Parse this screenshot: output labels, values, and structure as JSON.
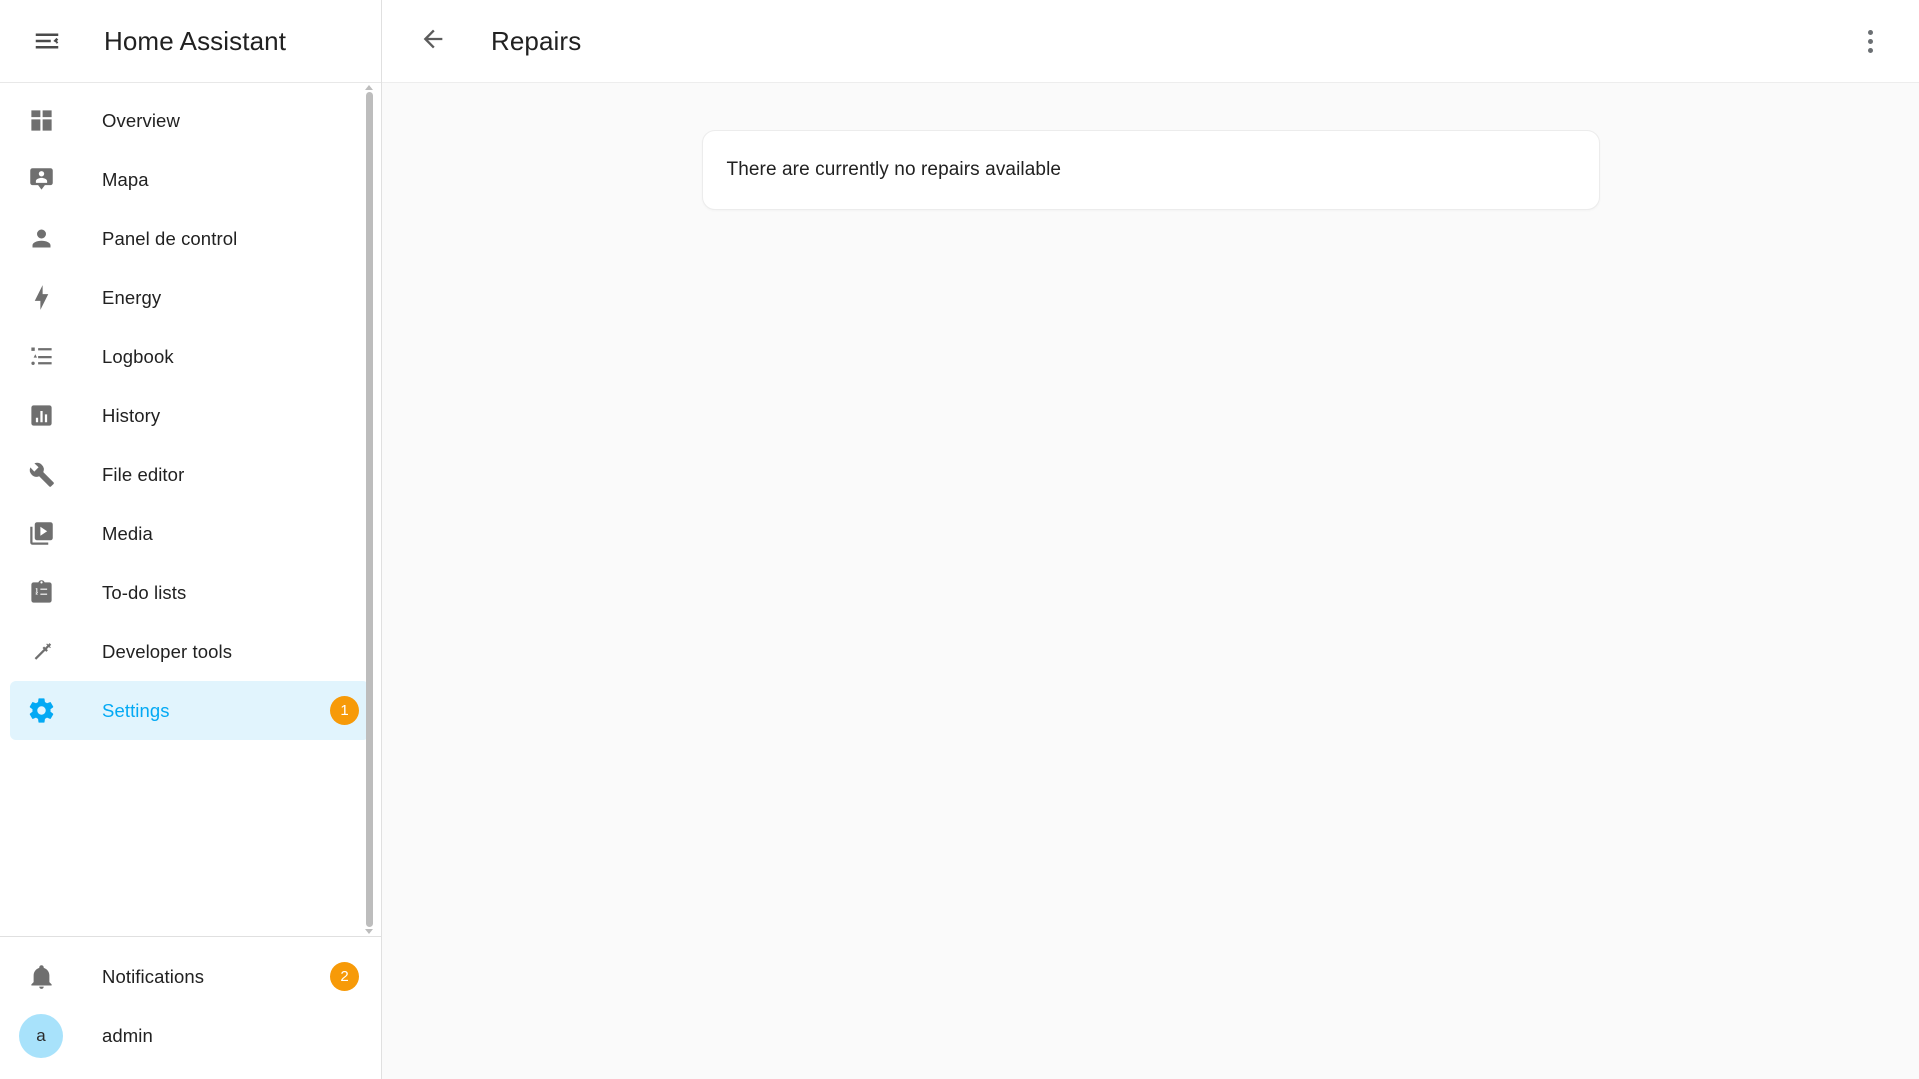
{
  "sidebar": {
    "title": "Home Assistant",
    "menu_icon": "menu-open-icon",
    "items": [
      {
        "label": "Overview",
        "icon": "view-dashboard-icon",
        "badge": null,
        "active": false
      },
      {
        "label": "Mapa",
        "icon": "map-marker-account-icon",
        "badge": null,
        "active": false
      },
      {
        "label": "Panel de control",
        "icon": "account-icon",
        "badge": null,
        "active": false
      },
      {
        "label": "Energy",
        "icon": "lightning-bolt-icon",
        "badge": null,
        "active": false
      },
      {
        "label": "Logbook",
        "icon": "format-list-bulleted-icon",
        "badge": null,
        "active": false
      },
      {
        "label": "History",
        "icon": "chart-box-icon",
        "badge": null,
        "active": false
      },
      {
        "label": "File editor",
        "icon": "wrench-icon",
        "badge": null,
        "active": false
      },
      {
        "label": "Media",
        "icon": "play-box-multiple-icon",
        "badge": null,
        "active": false
      },
      {
        "label": "To-do lists",
        "icon": "clipboard-list-icon",
        "badge": null,
        "active": false
      },
      {
        "label": "Developer tools",
        "icon": "hammer-icon",
        "badge": null,
        "active": false
      },
      {
        "label": "Settings",
        "icon": "cog-icon",
        "badge": "1",
        "active": true
      }
    ],
    "footer": {
      "notifications": {
        "label": "Notifications",
        "icon": "bell-icon",
        "badge": "2"
      },
      "user": {
        "label": "admin",
        "avatar_initial": "a"
      }
    }
  },
  "toolbar": {
    "back_icon": "arrow-left-icon",
    "title": "Repairs",
    "overflow_icon": "dots-vertical-icon"
  },
  "content": {
    "card_message": "There are currently no repairs available"
  },
  "colors": {
    "accent": "#03a9f4",
    "active_background": "#e1f4fd",
    "badge": "#f79a08",
    "avatar": "#a8e2fb",
    "icon_grey": "#6f6f6f",
    "page_background": "#fafafa"
  }
}
